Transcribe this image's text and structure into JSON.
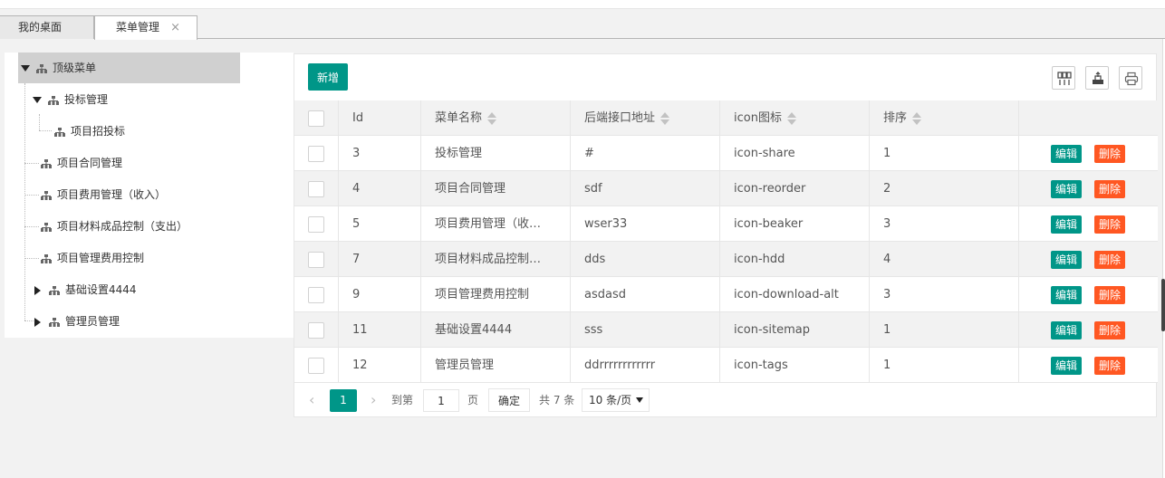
{
  "tabs": {
    "home_label": "我的桌面",
    "active_label": "菜单管理",
    "close_glyph": "×"
  },
  "tree": {
    "root": "顶级菜单",
    "nodes": [
      {
        "label": "投标管理",
        "expanded": true
      },
      {
        "label": "项目招投标"
      },
      {
        "label": "项目合同管理"
      },
      {
        "label": "项目费用管理（收入）"
      },
      {
        "label": "项目材料成品控制（支出）"
      },
      {
        "label": "项目管理费用控制"
      },
      {
        "label": "基础设置4444",
        "expanded": false
      },
      {
        "label": "管理员管理",
        "expanded": false
      }
    ]
  },
  "toolbar": {
    "add_label": "新增",
    "tool_icons": [
      "columns-icon",
      "export-icon",
      "print-icon"
    ]
  },
  "table": {
    "headers": {
      "id": "Id",
      "name": "菜单名称",
      "url": "后端接口地址",
      "icon": "icon图标",
      "sort": "排序"
    },
    "edit_label": "编辑",
    "delete_label": "删除",
    "rows": [
      {
        "id": "3",
        "name": "投标管理",
        "url": "#",
        "icon": "icon-share",
        "sort": "1"
      },
      {
        "id": "4",
        "name": "项目合同管理",
        "url": "sdf",
        "icon": "icon-reorder",
        "sort": "2"
      },
      {
        "id": "5",
        "name": "项目费用管理（收…",
        "url": "wser33",
        "icon": "icon-beaker",
        "sort": "3"
      },
      {
        "id": "7",
        "name": "项目材料成品控制…",
        "url": "dds",
        "icon": "icon-hdd",
        "sort": "4"
      },
      {
        "id": "9",
        "name": "项目管理费用控制",
        "url": "asdasd",
        "icon": "icon-download-alt",
        "sort": "3"
      },
      {
        "id": "11",
        "name": "基础设置4444",
        "url": "sss",
        "icon": "icon-sitemap",
        "sort": "1"
      },
      {
        "id": "12",
        "name": "管理员管理",
        "url": "ddrrrrrrrrrrrr",
        "icon": "icon-tags",
        "sort": "1"
      }
    ]
  },
  "pager": {
    "prev": "‹",
    "current": "1",
    "next": "›",
    "goto_label": "到第",
    "page_input": "1",
    "page_unit": "页",
    "confirm_label": "确定",
    "total_label": "共 7 条",
    "page_size": "10 条/页"
  },
  "colors": {
    "primary": "#009688",
    "danger": "#ff5722",
    "selected_tree": "#d0d0d0"
  }
}
